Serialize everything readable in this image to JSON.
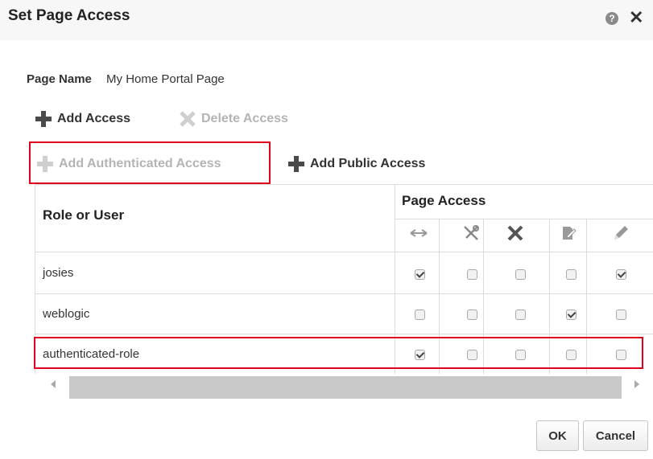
{
  "dialog": {
    "title": "Set Page Access"
  },
  "page_name": {
    "label": "Page Name",
    "value": "My Home Portal Page"
  },
  "toolbar": {
    "add_access": "Add Access",
    "delete_access": "Delete Access",
    "add_authenticated_access": "Add Authenticated Access",
    "add_public_access": "Add Public Access"
  },
  "table": {
    "role_header": "Role or User",
    "access_header": "Page Access",
    "permission_icons": [
      "view-icon",
      "customize-icon",
      "delete-icon",
      "edit-content-icon",
      "edit-icon"
    ],
    "rows": [
      {
        "name": "josies",
        "perms": [
          true,
          false,
          false,
          false,
          true
        ]
      },
      {
        "name": "weblogic",
        "perms": [
          false,
          false,
          false,
          true,
          false
        ]
      },
      {
        "name": "authenticated-role",
        "perms": [
          true,
          false,
          false,
          false,
          false
        ]
      }
    ]
  },
  "buttons": {
    "ok": "OK",
    "cancel": "Cancel"
  },
  "colors": {
    "highlight": "#e0001b",
    "disabled_text": "#b4b4b4"
  }
}
